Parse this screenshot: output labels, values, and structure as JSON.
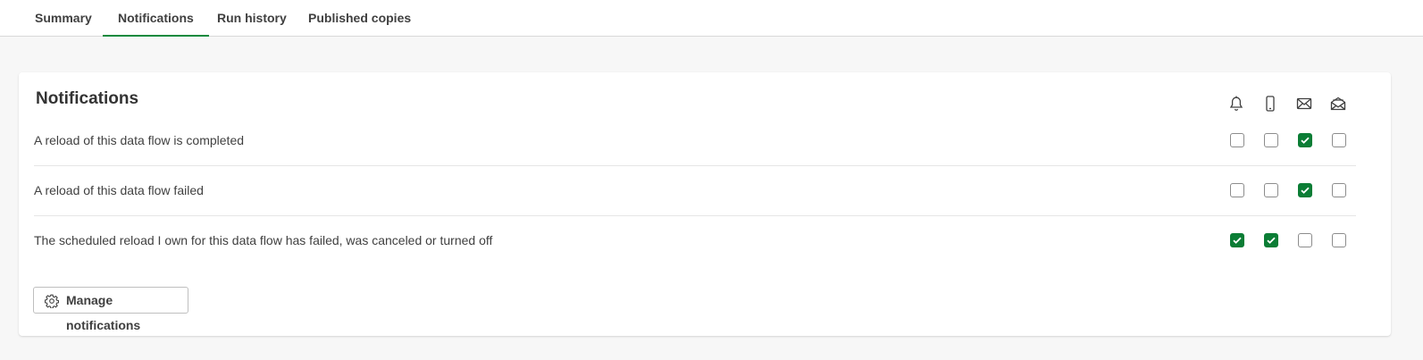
{
  "tabs": [
    {
      "label": "Summary",
      "active": false
    },
    {
      "label": "Notifications",
      "active": true
    },
    {
      "label": "Run history",
      "active": false
    },
    {
      "label": "Published copies",
      "active": false
    }
  ],
  "notifications": {
    "title": "Notifications",
    "channels": [
      "bell-icon",
      "mobile-phone-icon",
      "email-icon",
      "email-digest-icon"
    ],
    "rows": [
      {
        "label": "A reload of this data flow is completed",
        "checked": [
          false,
          false,
          true,
          false
        ]
      },
      {
        "label": "A reload of this data flow failed",
        "checked": [
          false,
          false,
          true,
          false
        ]
      },
      {
        "label": "The scheduled reload I own for this data flow has failed, was canceled or turned off",
        "checked": [
          true,
          true,
          false,
          false
        ]
      }
    ],
    "manage_button": "Manage notifications"
  },
  "colors": {
    "accent": "#0b7d35",
    "tab_underline": "#0f8a3e"
  }
}
